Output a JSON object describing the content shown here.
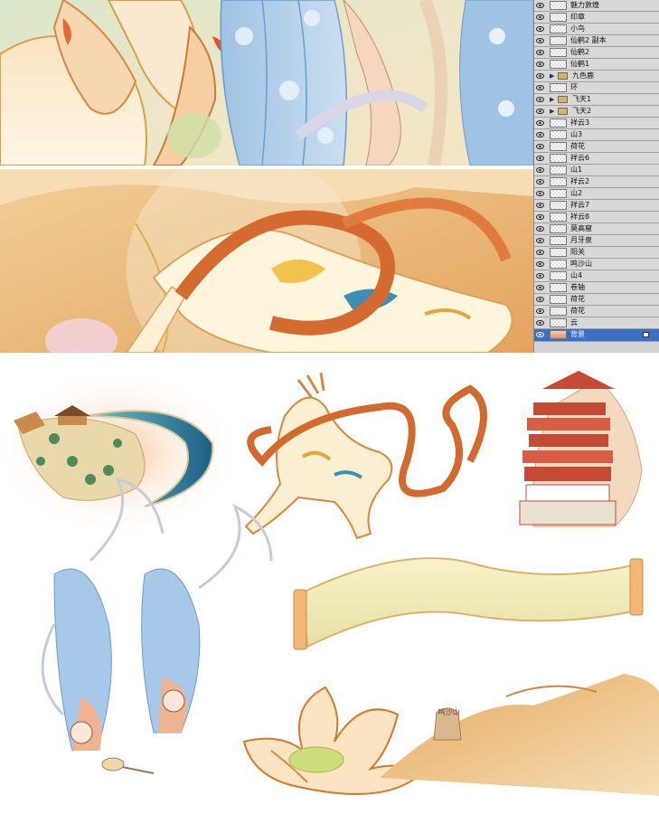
{
  "layers_panel": {
    "layers": [
      {
        "name": "魅力敦煌",
        "kind": "layer"
      },
      {
        "name": "印章",
        "kind": "layer"
      },
      {
        "name": "小鸟",
        "kind": "layer"
      },
      {
        "name": "仙鹤2 副本",
        "kind": "layer"
      },
      {
        "name": "仙鹤2",
        "kind": "layer"
      },
      {
        "name": "仙鹤1",
        "kind": "layer"
      },
      {
        "name": "九色鹿",
        "kind": "group"
      },
      {
        "name": "环",
        "kind": "layer"
      },
      {
        "name": "飞天1",
        "kind": "group"
      },
      {
        "name": "飞天2",
        "kind": "group"
      },
      {
        "name": "祥云3",
        "kind": "layer"
      },
      {
        "name": "山3",
        "kind": "layer"
      },
      {
        "name": "荷花",
        "kind": "layer"
      },
      {
        "name": "祥云6",
        "kind": "layer"
      },
      {
        "name": "山1",
        "kind": "layer"
      },
      {
        "name": "祥云2",
        "kind": "layer"
      },
      {
        "name": "山2",
        "kind": "layer"
      },
      {
        "name": "祥云7",
        "kind": "layer"
      },
      {
        "name": "祥云8",
        "kind": "layer"
      },
      {
        "name": "莫高窟",
        "kind": "layer"
      },
      {
        "name": "月牙泉",
        "kind": "layer"
      },
      {
        "name": "阳关",
        "kind": "layer"
      },
      {
        "name": "鸣沙山",
        "kind": "layer"
      },
      {
        "name": "山4",
        "kind": "layer"
      },
      {
        "name": "卷轴",
        "kind": "layer"
      },
      {
        "name": "荷花",
        "kind": "layer"
      },
      {
        "name": "荷花",
        "kind": "layer"
      },
      {
        "name": "云",
        "kind": "layer"
      },
      {
        "name": "背景",
        "kind": "background",
        "selected": true
      }
    ]
  },
  "canvas": {
    "stone_inscription": "鸣沙山"
  },
  "colors": {
    "selected_layer": "#3a6fc4",
    "panel_bg": "#d4d4d4",
    "sand": "#e9b574",
    "robe_blue": "#a8c8e6",
    "ribbon_orange": "#d9713a"
  }
}
